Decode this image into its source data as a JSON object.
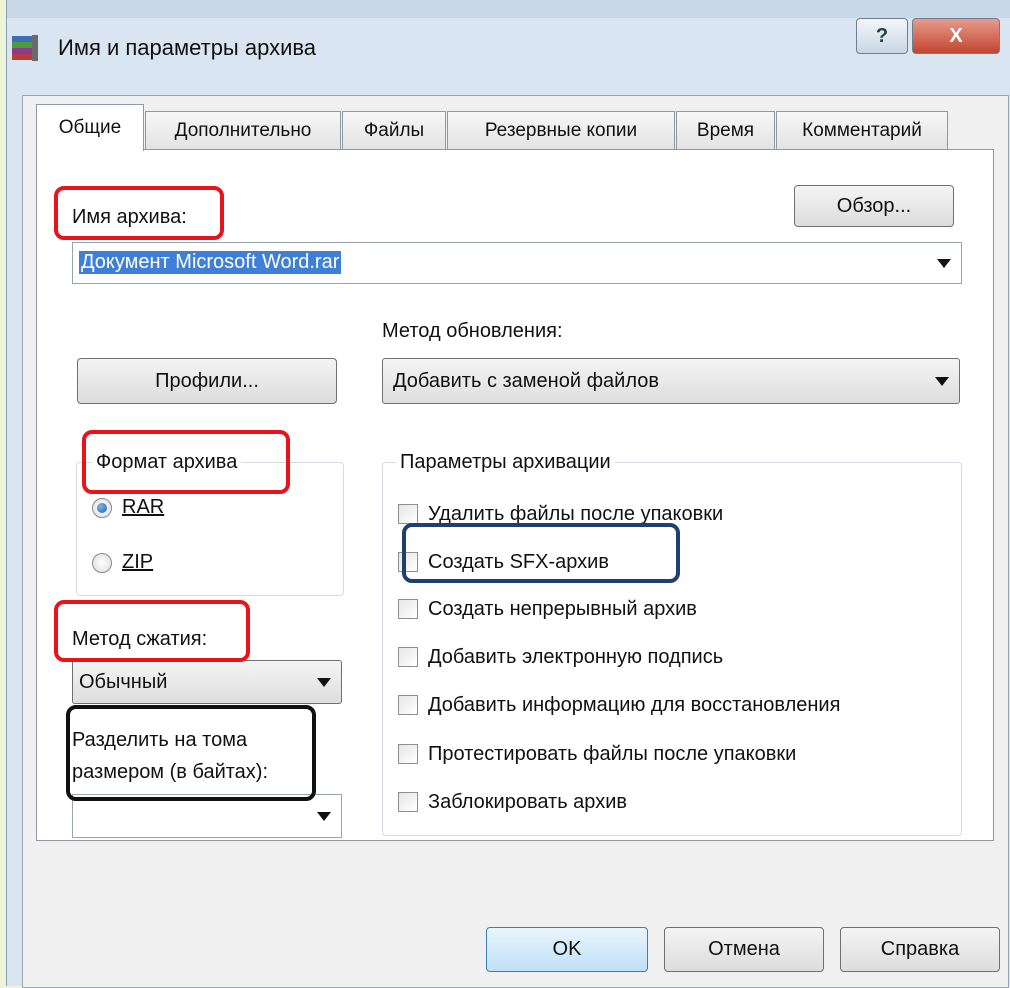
{
  "window": {
    "title": "Имя и параметры архива",
    "help_glyph": "?",
    "close_glyph": "X"
  },
  "tabs": [
    {
      "label": "Общие",
      "active": true
    },
    {
      "label": "Дополнительно",
      "active": false
    },
    {
      "label": "Файлы",
      "active": false
    },
    {
      "label": "Резервные копии",
      "active": false
    },
    {
      "label": "Время",
      "active": false
    },
    {
      "label": "Комментарий",
      "active": false
    }
  ],
  "archive_name": {
    "label": "Имя архива:",
    "value": "Документ Microsoft Word.rar",
    "browse_button": "Обзор..."
  },
  "profiles_button": "Профили...",
  "update_method": {
    "label": "Метод обновления:",
    "value": "Добавить с заменой файлов"
  },
  "archive_format": {
    "label": "Формат архива",
    "options": [
      {
        "label": "RAR",
        "selected": true
      },
      {
        "label": "ZIP",
        "selected": false
      }
    ]
  },
  "compression_method": {
    "label": "Метод сжатия:",
    "value": "Обычный"
  },
  "split_volumes": {
    "label_line1": "Разделить на тома",
    "label_line2": "размером (в байтах):",
    "value": ""
  },
  "archiving_options": {
    "label": "Параметры архивации",
    "items": [
      {
        "label": "Удалить файлы после упаковки",
        "checked": false
      },
      {
        "label": "Создать SFX-архив",
        "checked": false
      },
      {
        "label": "Создать непрерывный архив",
        "checked": false
      },
      {
        "label": "Добавить электронную подпись",
        "checked": false
      },
      {
        "label": "Добавить информацию для восстановления",
        "checked": false
      },
      {
        "label": "Протестировать файлы после упаковки",
        "checked": false
      },
      {
        "label": "Заблокировать архив",
        "checked": false
      }
    ]
  },
  "footer": {
    "ok": "OK",
    "cancel": "Отмена",
    "help": "Справка"
  },
  "colors": {
    "highlight_red": "#e8141b",
    "highlight_blue": "#1f3f73",
    "highlight_black": "#111111",
    "selection": "#3f7fd6"
  }
}
